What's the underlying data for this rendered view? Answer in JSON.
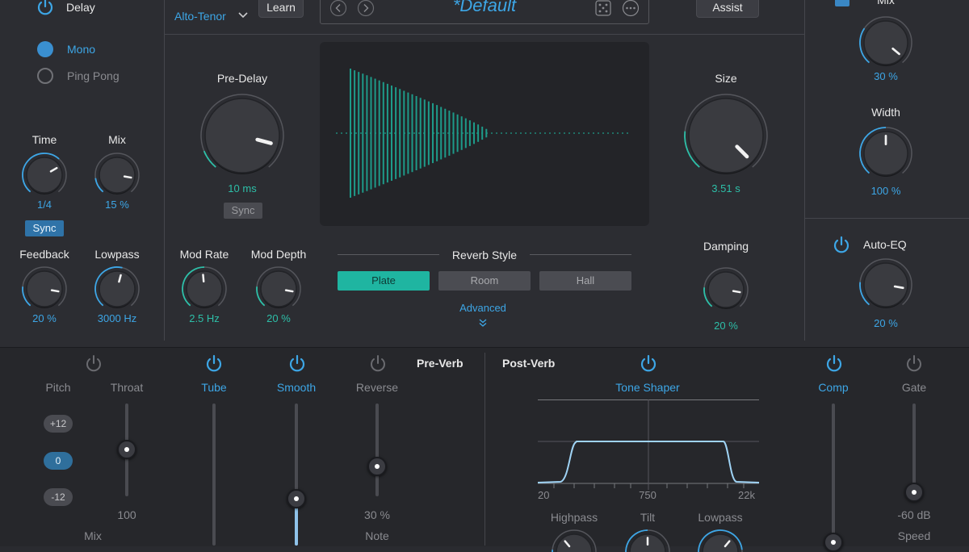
{
  "header": {
    "delay_label": "Delay",
    "preset_dropdown": "Alto-Tenor",
    "learn_label": "Learn",
    "preset_name": "*Default",
    "assist_label": "Assist",
    "mix_label_top": "Mix"
  },
  "delay_section": {
    "modes": [
      {
        "label": "Mono",
        "selected": true
      },
      {
        "label": "Ping Pong",
        "selected": false
      }
    ],
    "time": {
      "label": "Time",
      "value": "1/4"
    },
    "mix": {
      "label": "Mix",
      "value": "15 %"
    },
    "sync_label": "Sync",
    "feedback": {
      "label": "Feedback",
      "value": "20 %"
    },
    "lowpass": {
      "label": "Lowpass",
      "value": "3000 Hz"
    }
  },
  "reverb": {
    "predelay": {
      "label": "Pre-Delay",
      "value": "10 ms",
      "sync_label": "Sync"
    },
    "mod_rate": {
      "label": "Mod Rate",
      "value": "2.5 Hz"
    },
    "mod_depth": {
      "label": "Mod Depth",
      "value": "20 %"
    },
    "style_label": "Reverb Style",
    "styles": [
      {
        "label": "Plate",
        "selected": true
      },
      {
        "label": "Room",
        "selected": false
      },
      {
        "label": "Hall",
        "selected": false
      }
    ],
    "advanced_label": "Advanced",
    "size": {
      "label": "Size",
      "value": "3.51 s"
    },
    "damping": {
      "label": "Damping",
      "value": "20 %"
    }
  },
  "output": {
    "mix_value": "30 %",
    "width": {
      "label": "Width",
      "value": "100 %"
    },
    "auto_eq": {
      "label": "Auto-EQ",
      "value": "20 %"
    }
  },
  "pre_verb": {
    "title": "Pre-Verb",
    "pitch": {
      "label": "Pitch",
      "options": [
        "+12",
        "0",
        "-12"
      ],
      "selected": "0"
    },
    "throat": {
      "label": "Throat",
      "value": "100"
    },
    "tube": {
      "label": "Tube"
    },
    "smooth": {
      "label": "Smooth"
    },
    "reverse": {
      "label": "Reverse",
      "value": "30 %"
    },
    "mix_label": "Mix",
    "note_label": "Note"
  },
  "post_verb": {
    "title": "Post-Verb",
    "tone_shaper": {
      "label": "Tone Shaper",
      "axis_labels": [
        "20",
        "750",
        "22k"
      ],
      "highpass": "Highpass",
      "tilt": "Tilt",
      "lowpass": "Lowpass"
    },
    "comp": {
      "label": "Comp"
    },
    "gate": {
      "label": "Gate",
      "value": "-60 dB",
      "speed_label": "Speed"
    }
  },
  "colors": {
    "blue": "#3da6e6",
    "teal": "#2dbfa8",
    "panel": "#2c2d32"
  }
}
